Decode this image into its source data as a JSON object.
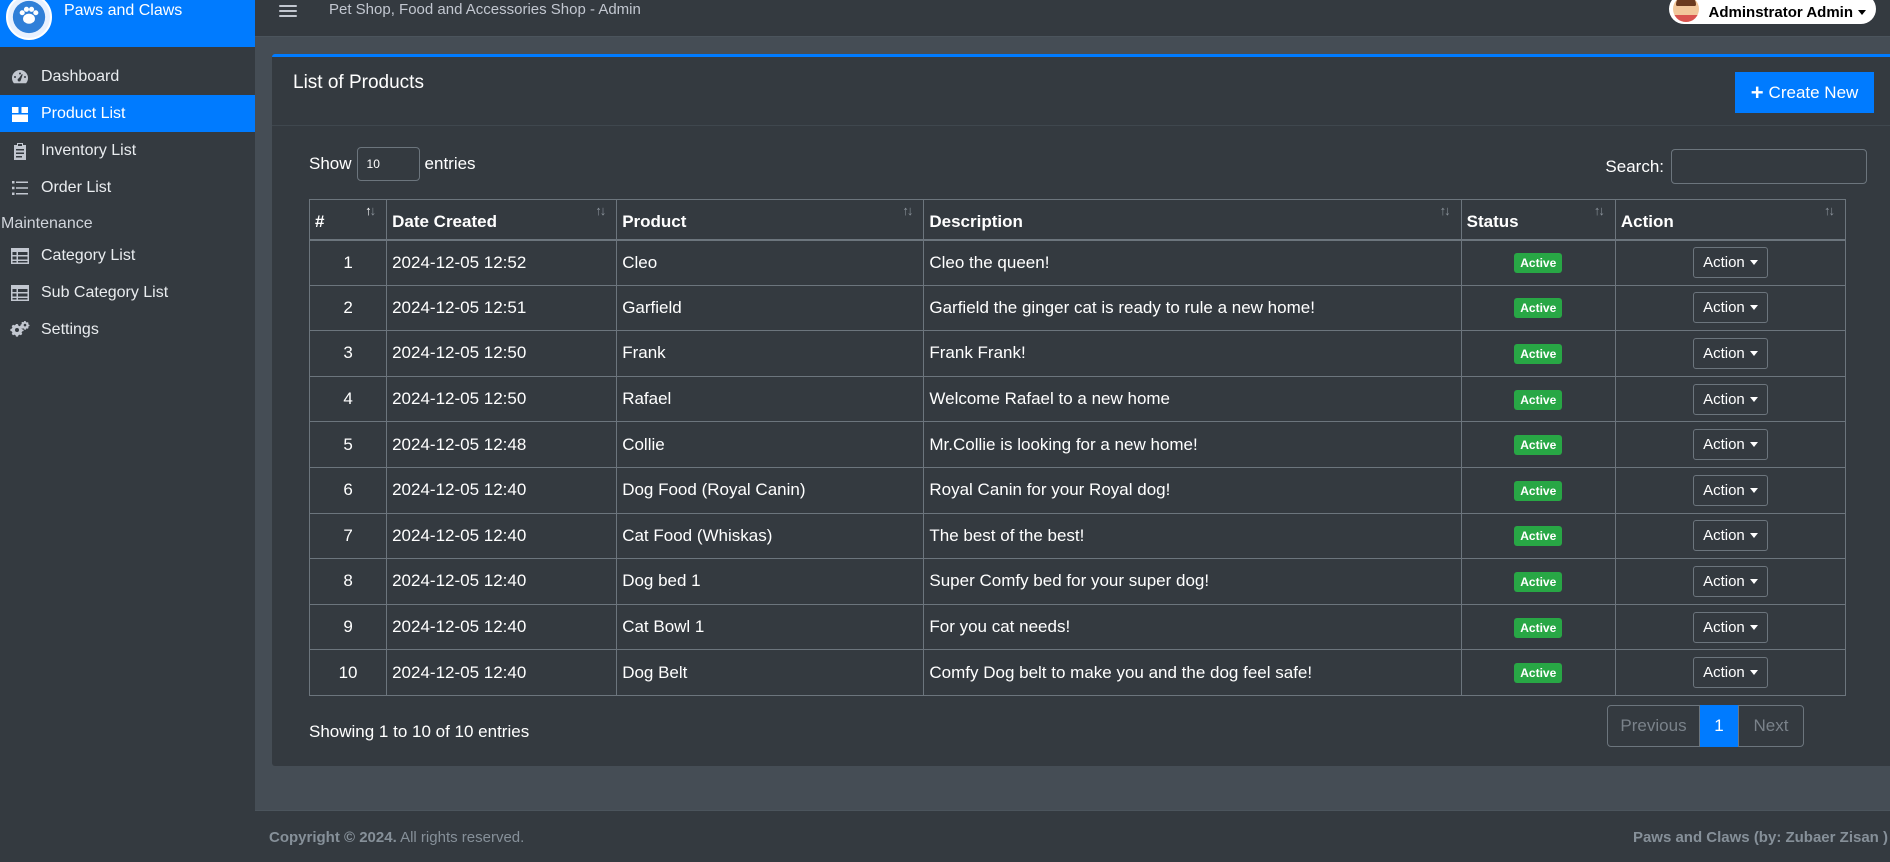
{
  "brand": {
    "name": "Paws and Claws"
  },
  "sidebar": {
    "items": [
      {
        "label": "Dashboard",
        "icon": "dashboard-icon",
        "active": false
      },
      {
        "label": "Product List",
        "icon": "box-icon",
        "active": true
      },
      {
        "label": "Inventory List",
        "icon": "clipboard-icon",
        "active": false
      },
      {
        "label": "Order List",
        "icon": "list-icon",
        "active": false
      }
    ],
    "section_header": "Maintenance",
    "maintenance_items": [
      {
        "label": "Category List",
        "icon": "table-icon"
      },
      {
        "label": "Sub Category List",
        "icon": "table-icon"
      },
      {
        "label": "Settings",
        "icon": "gears-icon"
      }
    ]
  },
  "topbar": {
    "title": "Pet Shop, Food and Accessories Shop - Admin",
    "user_name": "Adminstrator Admin"
  },
  "card": {
    "title": "List of Products",
    "create_button": "Create New"
  },
  "table_controls": {
    "show_label": "Show",
    "entries_value": "10",
    "entries_label": "entries",
    "search_label": "Search:",
    "search_value": ""
  },
  "table": {
    "columns": [
      "#",
      "Date Created",
      "Product",
      "Description",
      "Status",
      "Action"
    ],
    "rows": [
      {
        "num": "1",
        "date": "2024-12-05 12:52",
        "product": "Cleo",
        "description": "Cleo the queen!",
        "status": "Active",
        "action": "Action"
      },
      {
        "num": "2",
        "date": "2024-12-05 12:51",
        "product": "Garfield",
        "description": "Garfield the ginger cat is ready to rule a new home!",
        "status": "Active",
        "action": "Action"
      },
      {
        "num": "3",
        "date": "2024-12-05 12:50",
        "product": "Frank",
        "description": "Frank Frank!",
        "status": "Active",
        "action": "Action"
      },
      {
        "num": "4",
        "date": "2024-12-05 12:50",
        "product": "Rafael",
        "description": "Welcome Rafael to a new home",
        "status": "Active",
        "action": "Action"
      },
      {
        "num": "5",
        "date": "2024-12-05 12:48",
        "product": "Collie",
        "description": "Mr.Collie is looking for a new home!",
        "status": "Active",
        "action": "Action"
      },
      {
        "num": "6",
        "date": "2024-12-05 12:40",
        "product": "Dog Food (Royal Canin)",
        "description": "Royal Canin for your Royal dog!",
        "status": "Active",
        "action": "Action"
      },
      {
        "num": "7",
        "date": "2024-12-05 12:40",
        "product": "Cat Food (Whiskas)",
        "description": "The best of the best!",
        "status": "Active",
        "action": "Action"
      },
      {
        "num": "8",
        "date": "2024-12-05 12:40",
        "product": "Dog bed 1",
        "description": "Super Comfy bed for your super dog!",
        "status": "Active",
        "action": "Action"
      },
      {
        "num": "9",
        "date": "2024-12-05 12:40",
        "product": "Cat Bowl 1",
        "description": "For you cat needs!",
        "status": "Active",
        "action": "Action"
      },
      {
        "num": "10",
        "date": "2024-12-05 12:40",
        "product": "Dog Belt",
        "description": "Comfy Dog belt to make you and the dog feel safe!",
        "status": "Active",
        "action": "Action"
      }
    ]
  },
  "pagination": {
    "info": "Showing 1 to 10 of 10 entries",
    "previous": "Previous",
    "current": "1",
    "next": "Next"
  },
  "footer": {
    "copyright": "Copyright © 2024.",
    "rights": "All rights reserved.",
    "credit": "Paws and Claws (by: Zubaer Zisan )"
  },
  "colors": {
    "primary": "#007bff",
    "sidebar_bg": "#343a40",
    "content_bg": "#454d55",
    "success": "#28a745"
  }
}
